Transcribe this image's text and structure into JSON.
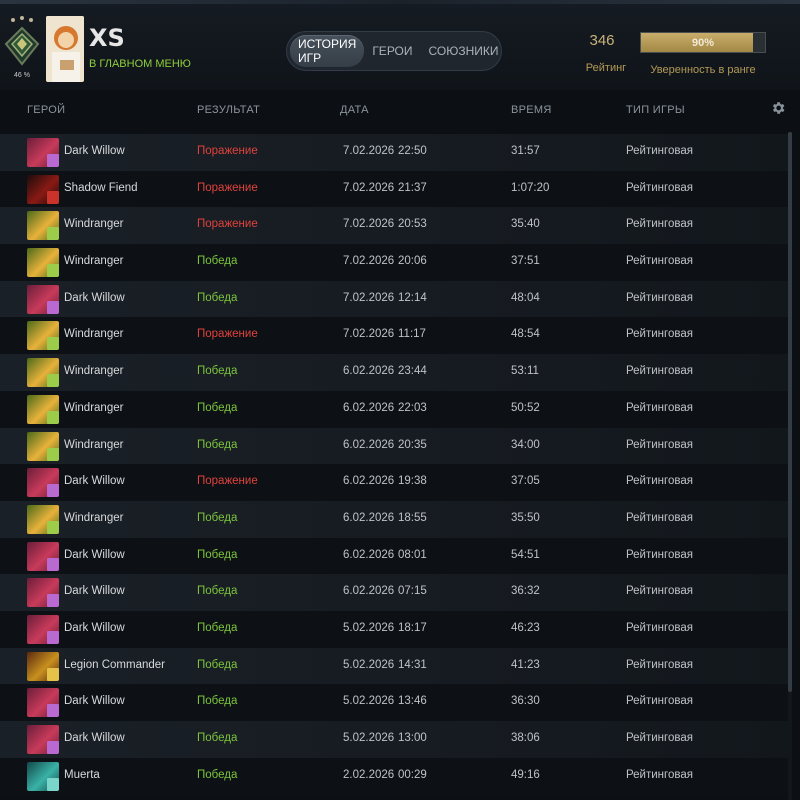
{
  "player": {
    "name": "XS",
    "status": "В ГЛАВНОМ МЕНЮ",
    "rank_badge": "46 %"
  },
  "tabs": [
    {
      "label": "ИСТОРИЯ ИГР",
      "active": true
    },
    {
      "label": "ГЕРОИ",
      "active": false
    },
    {
      "label": "СОЮЗНИКИ",
      "active": false
    }
  ],
  "rating": {
    "value": "346",
    "label": "Рейтинг"
  },
  "confidence": {
    "value_text": "90%",
    "fraction": 0.9,
    "label": "Уверенность в ранге"
  },
  "columns": {
    "hero": "ГЕРОЙ",
    "result": "РЕЗУЛЬТАТ",
    "date": "ДАТА",
    "duration": "ВРЕМЯ",
    "type": "ТИП ИГРЫ"
  },
  "settings_icon": "gear-icon",
  "colors": {
    "win": "#7cc43c",
    "loss": "#e0423b",
    "gold": "#c9ad6a"
  },
  "matches": [
    {
      "hero": "Dark Willow",
      "result": "Поражение",
      "outcome": "loss",
      "date": "7.02.2026",
      "time": "22:50",
      "duration": "31:57",
      "type": "Рейтинговая"
    },
    {
      "hero": "Shadow Fiend",
      "result": "Поражение",
      "outcome": "loss",
      "date": "7.02.2026",
      "time": "21:37",
      "duration": "1:07:20",
      "type": "Рейтинговая"
    },
    {
      "hero": "Windranger",
      "result": "Поражение",
      "outcome": "loss",
      "date": "7.02.2026",
      "time": "20:53",
      "duration": "35:40",
      "type": "Рейтинговая"
    },
    {
      "hero": "Windranger",
      "result": "Победа",
      "outcome": "win",
      "date": "7.02.2026",
      "time": "20:06",
      "duration": "37:51",
      "type": "Рейтинговая"
    },
    {
      "hero": "Dark Willow",
      "result": "Победа",
      "outcome": "win",
      "date": "7.02.2026",
      "time": "12:14",
      "duration": "48:04",
      "type": "Рейтинговая"
    },
    {
      "hero": "Windranger",
      "result": "Поражение",
      "outcome": "loss",
      "date": "7.02.2026",
      "time": "11:17",
      "duration": "48:54",
      "type": "Рейтинговая"
    },
    {
      "hero": "Windranger",
      "result": "Победа",
      "outcome": "win",
      "date": "6.02.2026",
      "time": "23:44",
      "duration": "53:11",
      "type": "Рейтинговая"
    },
    {
      "hero": "Windranger",
      "result": "Победа",
      "outcome": "win",
      "date": "6.02.2026",
      "time": "22:03",
      "duration": "50:52",
      "type": "Рейтинговая"
    },
    {
      "hero": "Windranger",
      "result": "Победа",
      "outcome": "win",
      "date": "6.02.2026",
      "time": "20:35",
      "duration": "34:00",
      "type": "Рейтинговая"
    },
    {
      "hero": "Dark Willow",
      "result": "Поражение",
      "outcome": "loss",
      "date": "6.02.2026",
      "time": "19:38",
      "duration": "37:05",
      "type": "Рейтинговая"
    },
    {
      "hero": "Windranger",
      "result": "Победа",
      "outcome": "win",
      "date": "6.02.2026",
      "time": "18:55",
      "duration": "35:50",
      "type": "Рейтинговая"
    },
    {
      "hero": "Dark Willow",
      "result": "Победа",
      "outcome": "win",
      "date": "6.02.2026",
      "time": "08:01",
      "duration": "54:51",
      "type": "Рейтинговая"
    },
    {
      "hero": "Dark Willow",
      "result": "Победа",
      "outcome": "win",
      "date": "6.02.2026",
      "time": "07:15",
      "duration": "36:32",
      "type": "Рейтинговая"
    },
    {
      "hero": "Dark Willow",
      "result": "Победа",
      "outcome": "win",
      "date": "5.02.2026",
      "time": "18:17",
      "duration": "46:23",
      "type": "Рейтинговая"
    },
    {
      "hero": "Legion Commander",
      "result": "Победа",
      "outcome": "win",
      "date": "5.02.2026",
      "time": "14:31",
      "duration": "41:23",
      "type": "Рейтинговая"
    },
    {
      "hero": "Dark Willow",
      "result": "Победа",
      "outcome": "win",
      "date": "5.02.2026",
      "time": "13:46",
      "duration": "36:30",
      "type": "Рейтинговая"
    },
    {
      "hero": "Dark Willow",
      "result": "Победа",
      "outcome": "win",
      "date": "5.02.2026",
      "time": "13:00",
      "duration": "38:06",
      "type": "Рейтинговая"
    },
    {
      "hero": "Muerta",
      "result": "Победа",
      "outcome": "win",
      "date": "2.02.2026",
      "time": "00:29",
      "duration": "49:16",
      "type": "Рейтинговая"
    }
  ]
}
